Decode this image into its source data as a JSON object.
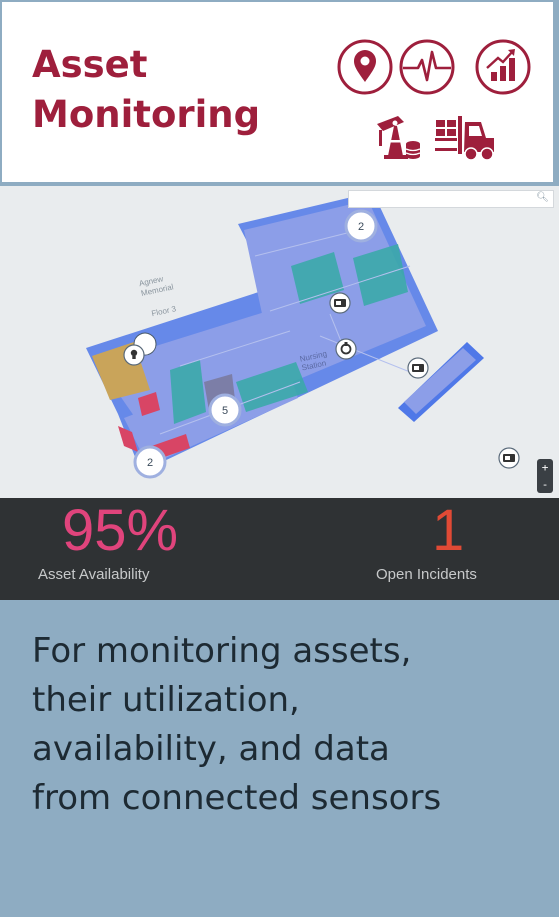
{
  "header": {
    "title_line1": "Asset",
    "title_line2": "Monitoring",
    "icons": [
      "location-pin-icon",
      "pulse-icon",
      "growth-chart-icon",
      "oil-pump-icon",
      "forklift-icon"
    ],
    "accent_color": "#9e1f3c"
  },
  "map": {
    "building_label_line1": "Agnew",
    "building_label_line2": "Memorial",
    "floor_label": "Floor 3",
    "station_label_line1": "Nursing",
    "station_label_line2": "Station",
    "search_placeholder": "",
    "cluster_markers": [
      "2",
      "5",
      "2"
    ],
    "zoom_in": "+",
    "zoom_out": "-"
  },
  "stats": {
    "availability_value": "95%",
    "availability_label": "Asset Availability",
    "availability_color": "#e0447c",
    "incidents_value": "1",
    "incidents_label": "Open Incidents",
    "incidents_color": "#e04a35"
  },
  "description": {
    "line1": "For monitoring assets,",
    "line2": "their utilization,",
    "line3": "availability, and data",
    "line4": "from connected sensors"
  }
}
